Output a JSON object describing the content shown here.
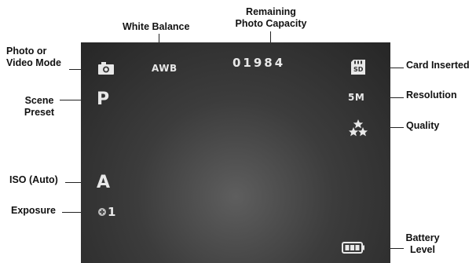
{
  "callouts": {
    "white_balance": "White Balance",
    "remaining_line1": "Remaining",
    "remaining_line2": "Photo Capacity",
    "photo_mode_line1": "Photo or",
    "photo_mode_line2": "Video Mode",
    "card_inserted": "Card Inserted",
    "scene_line1": "Scene",
    "scene_line2": "Preset",
    "resolution": "Resolution",
    "quality": "Quality",
    "iso": "ISO (Auto)",
    "exposure": "Exposure",
    "battery_line1": "Battery",
    "battery_line2": "Level"
  },
  "osd": {
    "awb": "AWB",
    "counter": "01984",
    "scene": "P",
    "resolution": "5M",
    "iso": "A",
    "exposure": "1",
    "card": "SD"
  },
  "icons": {
    "mode": "camera-icon",
    "card": "sd-card-icon",
    "quality": "stars-icon",
    "exposure": "exposure-icon",
    "battery": "battery-icon"
  },
  "colors": {
    "screen_center": "#5e5e5e",
    "screen_edge": "#262626",
    "osd_text": "#e8e8e8",
    "callout_text": "#111111"
  }
}
